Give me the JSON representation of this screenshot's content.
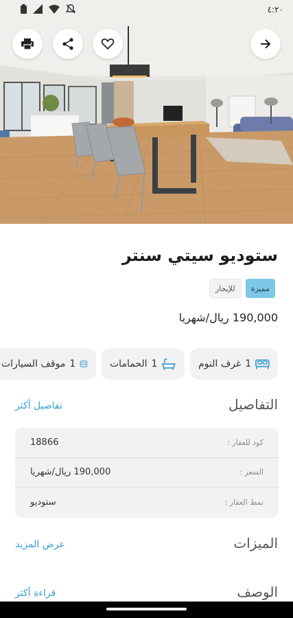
{
  "status_bar": {
    "time": "٤:٢٠",
    "icons": [
      "mute-icon",
      "wifi-icon",
      "signal-icon",
      "battery-icon"
    ]
  },
  "actions": {
    "print": "print-icon",
    "share": "share-icon",
    "favorite": "heart-icon",
    "forward": "arrow-right-icon"
  },
  "property": {
    "title": "ستوديو سيتي سنتر",
    "badges": {
      "featured": "مميزة",
      "for_rent": "للإيجار"
    },
    "price": "190,000 ريال/شهريا"
  },
  "features": {
    "beds": {
      "count": "1",
      "label": "غرف النوم",
      "icon": "bed-icon"
    },
    "baths": {
      "count": "1",
      "label": "الحمامات",
      "icon": "bath-icon"
    },
    "parking": {
      "count": "1",
      "label": "موقف السيارات",
      "icon": "car-icon"
    }
  },
  "details": {
    "title": "التفاصيل",
    "more_link": "تفاصيل أكثر",
    "rows": [
      {
        "label": "كود للعقار :",
        "value": "18866"
      },
      {
        "label": "السعر :",
        "value": "190,000 ريال/شهريا"
      },
      {
        "label": "نمط العقار :",
        "value": "ستوديو"
      }
    ]
  },
  "amenities": {
    "title": "الميزات",
    "more_link": "عرض المزيد"
  },
  "description": {
    "title": "الوصف",
    "more_link": "قراءة أكثر"
  },
  "colors": {
    "accent": "#3aa0d6",
    "badge_featured": "#7dc8e6",
    "chip_bg": "#f2f2f2"
  }
}
